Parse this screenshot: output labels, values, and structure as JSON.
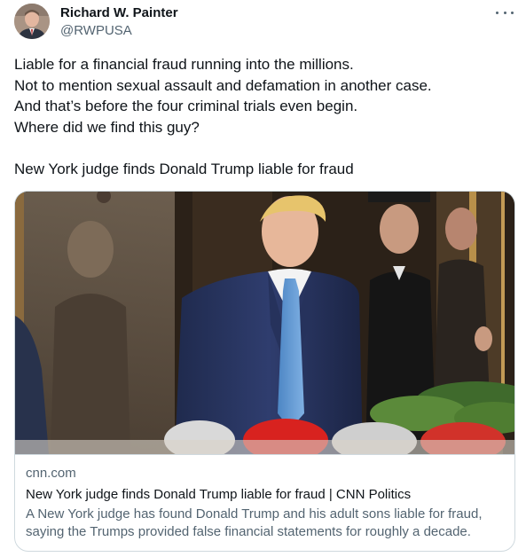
{
  "author": {
    "name": "Richard W. Painter",
    "handle": "@RWPUSA"
  },
  "tweet": {
    "lines": [
      "Liable for a financial fraud running into the millions.",
      "Not to mention sexual assault and defamation in another case.",
      "And that’s before the four criminal trials even begin.",
      "Where did we find this guy?"
    ],
    "headline": "New York judge finds Donald Trump liable for fraud"
  },
  "card": {
    "domain": "cnn.com",
    "title": "New York judge finds Donald Trump liable for fraud | CNN Politics",
    "description": "A New York judge has found Donald Trump and his adult sons liable for fraud, saying the Trumps provided false financial statements for roughly a decade."
  },
  "icons": {
    "more": "more-horizontal-icon"
  },
  "colors": {
    "text_primary": "#0f1419",
    "text_secondary": "#536471",
    "border": "#cfd9de"
  }
}
